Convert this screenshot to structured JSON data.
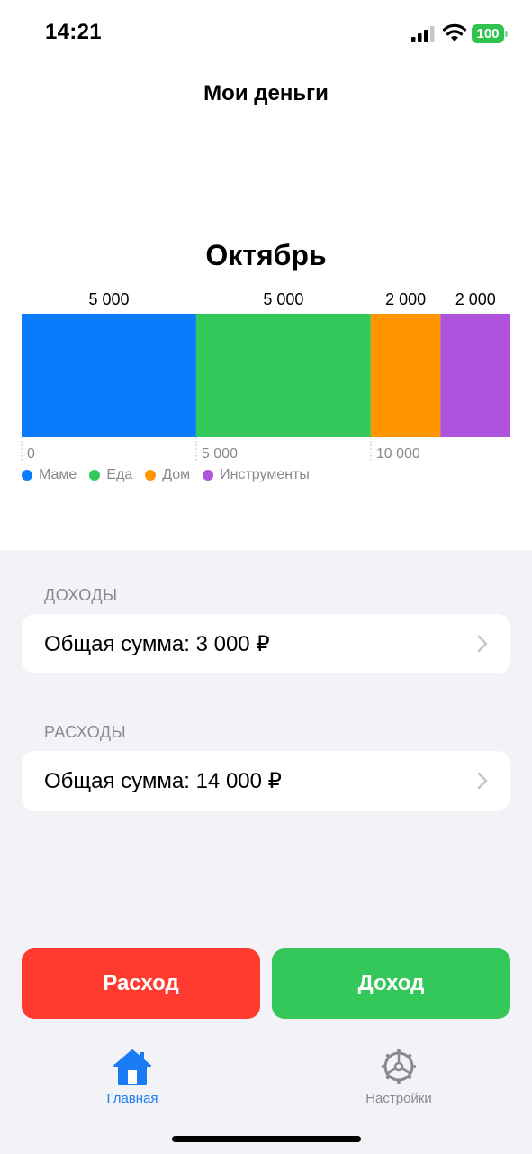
{
  "status_bar": {
    "time": "14:21",
    "battery": "100"
  },
  "header": {
    "title": "Мои деньги"
  },
  "chart_data": {
    "type": "bar",
    "orientation": "horizontal-stacked",
    "title": "Октябрь",
    "categories": [
      "Маме",
      "Еда",
      "Дом",
      "Инструменты"
    ],
    "values": [
      5000,
      5000,
      2000,
      2000
    ],
    "value_labels": [
      "5 000",
      "5 000",
      "2 000",
      "2 000"
    ],
    "colors": [
      "#0a7aff",
      "#34c759",
      "#ff9500",
      "#af52de"
    ],
    "axis_ticks": [
      0,
      5000,
      10000
    ],
    "tick_labels": [
      "0",
      "5 000",
      "10 000"
    ],
    "xlim": [
      0,
      14000
    ],
    "legend_position": "bottom-left"
  },
  "income": {
    "header": "ДОХОДЫ",
    "total_label": "Общая сумма: 3 000 ₽"
  },
  "expenses": {
    "header": "РАСХОДЫ",
    "total_label": "Общая сумма: 14 000 ₽"
  },
  "buttons": {
    "expense": "Расход",
    "income": "Доход"
  },
  "tabbar": {
    "tabs": [
      {
        "label": "Главная",
        "icon": "house-icon",
        "active": true
      },
      {
        "label": "Настройки",
        "icon": "gear-icon",
        "active": false
      }
    ],
    "active_color": "#1a7cf5",
    "inactive_color": "#8a8a8e"
  }
}
